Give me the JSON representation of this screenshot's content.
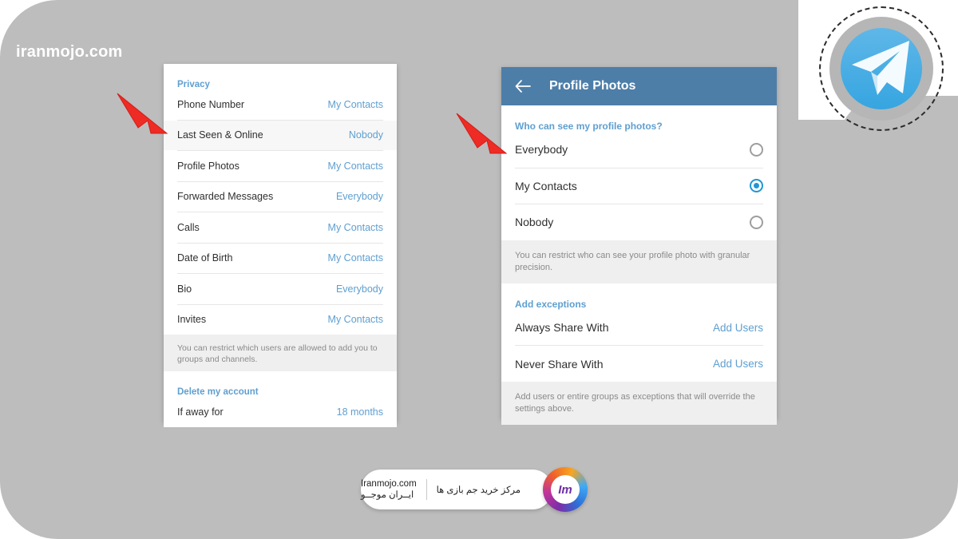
{
  "watermark": {
    "top_left": "iranmojo.com"
  },
  "logo": {
    "telegram_icon": "telegram-paper-plane-icon"
  },
  "left_panel": {
    "section_privacy_title": "Privacy",
    "rows": [
      {
        "label": "Phone Number",
        "value": "My Contacts"
      },
      {
        "label": "Last Seen & Online",
        "value": "Nobody"
      },
      {
        "label": "Profile Photos",
        "value": "My Contacts"
      },
      {
        "label": "Forwarded Messages",
        "value": "Everybody"
      },
      {
        "label": "Calls",
        "value": "My Contacts"
      },
      {
        "label": "Date of Birth",
        "value": "My Contacts"
      },
      {
        "label": "Bio",
        "value": "Everybody"
      },
      {
        "label": "Invites",
        "value": "My Contacts"
      }
    ],
    "info_text": "You can restrict which users are allowed to add you to groups and channels.",
    "section_delete_title": "Delete my account",
    "delete_row": {
      "label": "If away for",
      "value": "18 months"
    }
  },
  "right_panel": {
    "appbar": {
      "back_icon": "back-arrow-icon",
      "title": "Profile Photos"
    },
    "section_who_title": "Who can see my profile photos?",
    "options": [
      {
        "label": "Everybody",
        "selected": false
      },
      {
        "label": "My Contacts",
        "selected": true
      },
      {
        "label": "Nobody",
        "selected": false
      }
    ],
    "info_text": "You can restrict who can see your profile photo with granular precision.",
    "section_exceptions_title": "Add exceptions",
    "exception_rows": [
      {
        "label": "Always Share With",
        "value": "Add Users"
      },
      {
        "label": "Never Share With",
        "value": "Add Users"
      }
    ],
    "exceptions_info_text": "Add users or entire groups as exceptions that will override the settings above."
  },
  "annotations": {
    "arrow_left_name": "red-arrow-pointing-last-seen",
    "arrow_right_name": "red-arrow-pointing-everybody"
  },
  "bottom_badge": {
    "fa_tagline": "مرکز خرید جم بازی ها",
    "en_line1": "Iranmojo.com",
    "en_line2": "ایــران موجــو",
    "logo_text": "Im"
  },
  "colors": {
    "accent_blue": "#5f9fd0",
    "appbar_blue": "#4d7ea8",
    "radio_blue": "#2196d4",
    "arrow_red": "#ee2b24",
    "canvas_gray": "#bdbdbd"
  }
}
